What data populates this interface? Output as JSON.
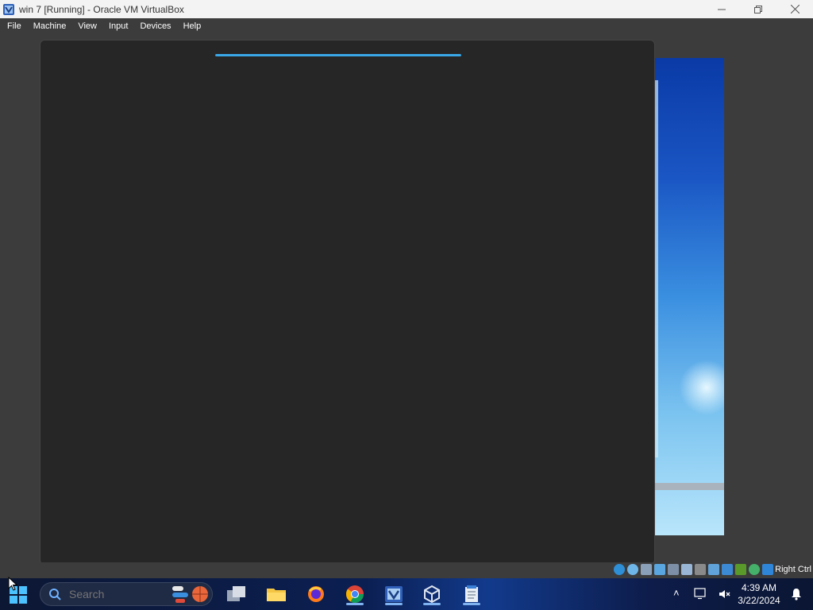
{
  "window": {
    "title": "win 7 [Running] - Oracle VM VirtualBox",
    "icon": "virtualbox-app-icon",
    "controls": [
      "minimize-icon",
      "restore-icon",
      "close-icon"
    ]
  },
  "menu": {
    "items": [
      "File",
      "Machine",
      "View",
      "Input",
      "Devices",
      "Help"
    ]
  },
  "guest": {
    "dialog_background": "#262626",
    "loading_progress_percent": 100,
    "loading_color": "#3aa8e8"
  },
  "vbox_status": {
    "icons": [
      "hard-disk-icon",
      "optical-drive-icon",
      "audio-icon",
      "network-icon",
      "usb-icon",
      "shared-folders-icon",
      "display-icon",
      "video-capture-icon",
      "screen-icon",
      "cpu-indicator-icon",
      "mouse-integration-icon",
      "keyboard-capture-icon"
    ],
    "host_key": "Right Ctrl"
  },
  "taskbar": {
    "search": {
      "placeholder": "Search",
      "value": ""
    },
    "apps": [
      "task-view-icon",
      "file-explorer-icon",
      "firefox-icon",
      "chrome-icon",
      "virtualbox-icon",
      "virtualbox-manager-icon",
      "notepad-icon"
    ],
    "clock": {
      "time": "4:39 AM",
      "date": "3/22/2024"
    }
  },
  "colors": {
    "accent": "#3aa8e8",
    "taskbar": "#0b1f52",
    "vm_background": "#3c3c3c"
  }
}
